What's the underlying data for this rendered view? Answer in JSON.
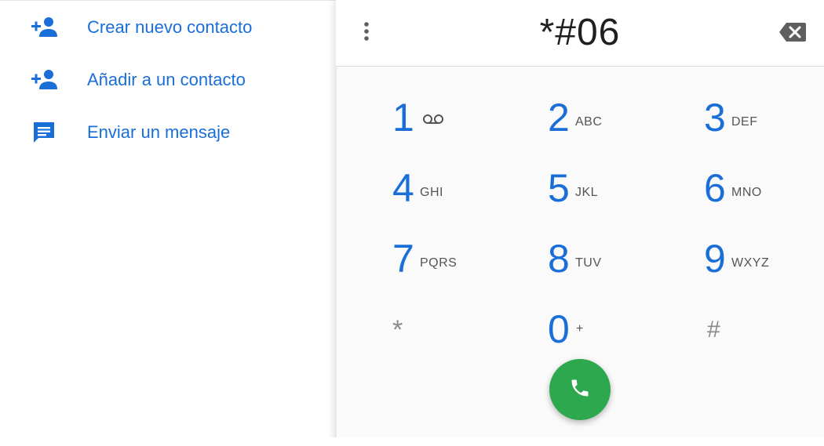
{
  "actions": [
    {
      "label": "Crear nuevo contacto",
      "icon": "person-add-icon"
    },
    {
      "label": "Añadir a un contacto",
      "icon": "person-add-icon"
    },
    {
      "label": "Enviar un mensaje",
      "icon": "message-icon"
    }
  ],
  "dialer": {
    "number": "*#06",
    "menu_icon": "more-vert-icon",
    "backspace_icon": "backspace-icon"
  },
  "keypad": {
    "keys": [
      {
        "digit": "1",
        "letters": ""
      },
      {
        "digit": "2",
        "letters": "ABC"
      },
      {
        "digit": "3",
        "letters": "DEF"
      },
      {
        "digit": "4",
        "letters": "GHI"
      },
      {
        "digit": "5",
        "letters": "JKL"
      },
      {
        "digit": "6",
        "letters": "MNO"
      },
      {
        "digit": "7",
        "letters": "PQRS"
      },
      {
        "digit": "8",
        "letters": "TUV"
      },
      {
        "digit": "9",
        "letters": "WXYZ"
      },
      {
        "digit": "*",
        "letters": ""
      },
      {
        "digit": "0",
        "letters": "+"
      },
      {
        "digit": "#",
        "letters": ""
      }
    ],
    "voicemail_icon": "voicemail-icon"
  },
  "call_button": {
    "icon": "phone-icon"
  },
  "colors": {
    "accent": "#1a6ed8",
    "call_green": "#2ea84f",
    "symbol_gray": "#8a8a8a"
  }
}
